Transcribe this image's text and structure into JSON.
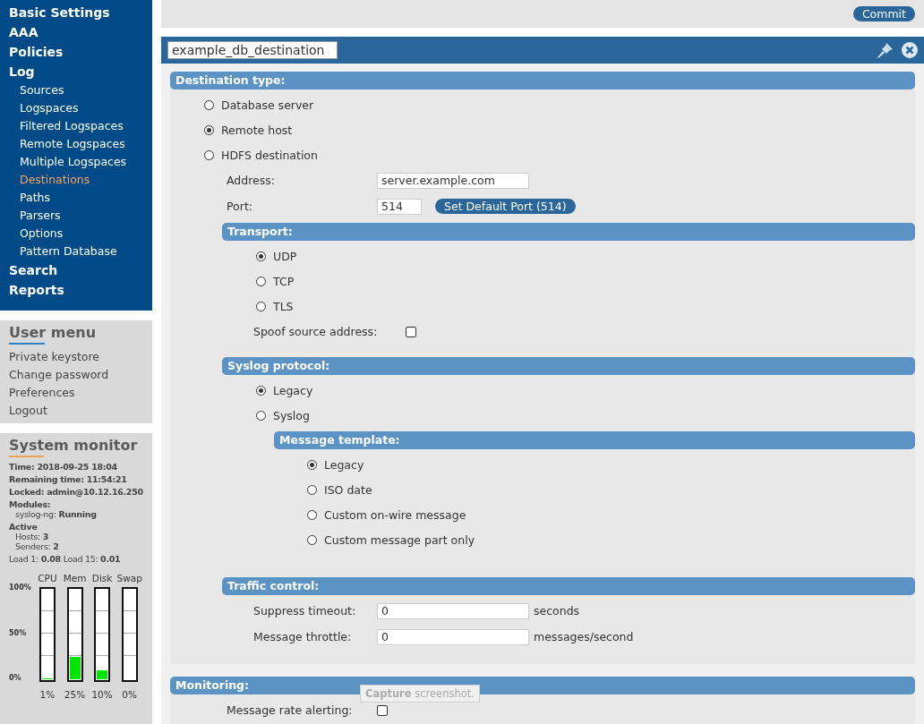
{
  "sidebar": {
    "nav": [
      {
        "label": "Basic Settings",
        "selected": false
      },
      {
        "label": "AAA",
        "selected": false
      },
      {
        "label": "Policies",
        "selected": false
      },
      {
        "label": "Log",
        "selected": false,
        "children": [
          {
            "label": "Sources",
            "selected": false
          },
          {
            "label": "Logspaces",
            "selected": false
          },
          {
            "label": "Filtered Logspaces",
            "selected": false
          },
          {
            "label": "Remote Logspaces",
            "selected": false
          },
          {
            "label": "Multiple Logspaces",
            "selected": false
          },
          {
            "label": "Destinations",
            "selected": true
          },
          {
            "label": "Paths",
            "selected": false
          },
          {
            "label": "Parsers",
            "selected": false
          },
          {
            "label": "Options",
            "selected": false
          },
          {
            "label": "Pattern Database",
            "selected": false
          }
        ]
      },
      {
        "label": "Search",
        "selected": false
      },
      {
        "label": "Reports",
        "selected": false
      }
    ],
    "user_menu": {
      "title": "User menu",
      "items": [
        "Private keystore",
        "Change password",
        "Preferences",
        "Logout"
      ]
    },
    "system_monitor": {
      "title": "System monitor",
      "lines": [
        "**Time: 2018-09-25 18:04**",
        "**Remaining time: 11:54:21**",
        "**Locked: admin@10.12.16.250**",
        "**Modules:**"
      ],
      "modules": [
        "syslog-ng: **Running**"
      ],
      "active_title": "Active",
      "active": [
        "Hosts: **3**",
        "Senders: **2**"
      ],
      "load": "Load 1: **0.08** Load 15: **0.01**",
      "axis": [
        "100%",
        "50%",
        "0%"
      ],
      "meters": [
        {
          "name": "CPU",
          "level": 0.01,
          "reading": "1%"
        },
        {
          "name": "Mem",
          "level": 0.25,
          "reading": "25%"
        },
        {
          "name": "Disk",
          "level": 0.1,
          "reading": "10%"
        },
        {
          "name": "Swap",
          "level": 0,
          "reading": "0%"
        }
      ]
    }
  },
  "toolbar": {
    "commit_button": "Commit"
  },
  "panel": {
    "name_value": "example_db_destination",
    "sections": [
      {
        "kind": "section",
        "title": "Destination type:",
        "items": [
          {
            "kind": "radio",
            "label": "Database server",
            "selected": false
          },
          {
            "kind": "radio",
            "label": "Remote host",
            "selected": true
          },
          {
            "kind": "radio",
            "label": "HDFS destination",
            "selected": false
          },
          {
            "kind": "field",
            "label": "Address:",
            "value": "server.example.com"
          },
          {
            "kind": "field",
            "label": "Port:",
            "value": "514",
            "button": "Set Default Port (514)"
          },
          {
            "kind": "section",
            "title": "Transport:",
            "items": [
              {
                "kind": "radio",
                "label": "UDP",
                "selected": true
              },
              {
                "kind": "radio",
                "label": "TCP",
                "selected": false
              },
              {
                "kind": "radio",
                "label": "TLS",
                "selected": false
              },
              {
                "kind": "checkbox",
                "label": "Spoof source address:",
                "checked": false
              }
            ]
          },
          {
            "kind": "section",
            "title": "Syslog protocol:",
            "items": [
              {
                "kind": "radio",
                "label": "Legacy",
                "selected": true
              },
              {
                "kind": "radio",
                "label": "Syslog",
                "selected": false
              },
              {
                "kind": "section",
                "title": "Message template:",
                "items": [
                  {
                    "kind": "radio",
                    "label": "Legacy",
                    "selected": true
                  },
                  {
                    "kind": "radio",
                    "label": "ISO date",
                    "selected": false
                  },
                  {
                    "kind": "radio",
                    "label": "Custom on-wire message",
                    "selected": false
                  },
                  {
                    "kind": "radio",
                    "label": "Custom message part only",
                    "selected": false
                  }
                ]
              }
            ]
          },
          {
            "kind": "section",
            "title": "Traffic control:",
            "items": [
              {
                "kind": "field",
                "label": "Suppress timeout:",
                "value": "0",
                "unit": "seconds"
              },
              {
                "kind": "field",
                "label": "Message throttle:",
                "value": "0",
                "unit": "messages/second"
              }
            ]
          }
        ]
      },
      {
        "kind": "section",
        "title": "Monitoring:",
        "items": [
          {
            "kind": "checkbox",
            "label": "Message rate alerting:",
            "checked": false
          }
        ]
      }
    ]
  },
  "tooltip": "**Capture** screenshot."
}
